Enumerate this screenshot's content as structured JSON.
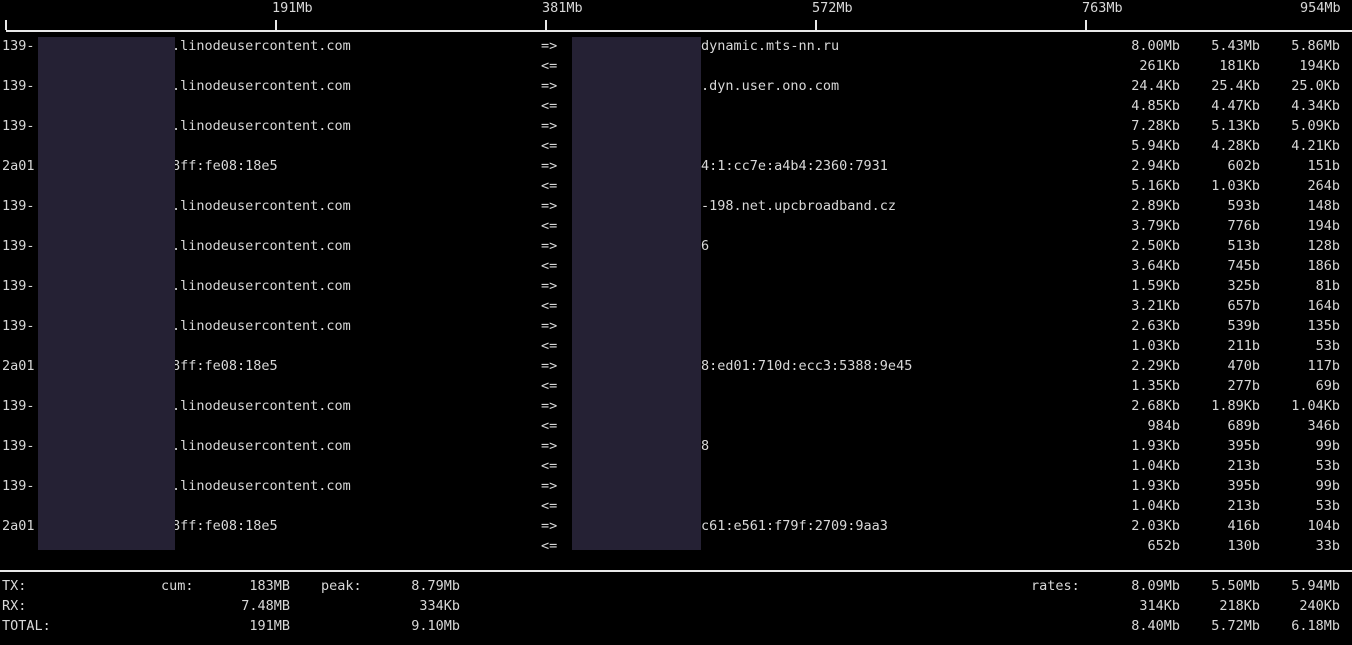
{
  "scale": {
    "ticks": [
      "191Mb",
      "381Mb",
      "572Mb",
      "763Mb",
      "954Mb"
    ]
  },
  "connections": [
    {
      "src": "139-",
      "src_suffix": ".linodeusercontent.com",
      "dst_suffix": "dynamic.mts-nn.ru",
      "tx_arrow": "=>",
      "rx_arrow": "<=",
      "tx": [
        "8.00Mb",
        "5.43Mb",
        "5.86Mb"
      ],
      "rx": [
        "261Kb",
        "181Kb",
        "194Kb"
      ]
    },
    {
      "src": "139-",
      "src_suffix": ".linodeusercontent.com",
      "dst_suffix": ".dyn.user.ono.com",
      "tx_arrow": "=>",
      "rx_arrow": "<=",
      "tx": [
        "24.4Kb",
        "25.4Kb",
        "25.0Kb"
      ],
      "rx": [
        "4.85Kb",
        "4.47Kb",
        "4.34Kb"
      ]
    },
    {
      "src": "139-",
      "src_suffix": ".linodeusercontent.com",
      "dst_suffix": "",
      "tx_arrow": "=>",
      "rx_arrow": "<=",
      "tx": [
        "7.28Kb",
        "5.13Kb",
        "5.09Kb"
      ],
      "rx": [
        "5.94Kb",
        "4.28Kb",
        "4.21Kb"
      ]
    },
    {
      "src": "2a01",
      "src_suffix": "8ff:fe08:18e5",
      "dst_suffix": "4:1:cc7e:a4b4:2360:7931",
      "tx_arrow": "=>",
      "rx_arrow": "<=",
      "tx": [
        "2.94Kb",
        "602b",
        "151b"
      ],
      "rx": [
        "5.16Kb",
        "1.03Kb",
        "264b"
      ]
    },
    {
      "src": "139-",
      "src_suffix": ".linodeusercontent.com",
      "dst_suffix": "-198.net.upcbroadband.cz",
      "tx_arrow": "=>",
      "rx_arrow": "<=",
      "tx": [
        "2.89Kb",
        "593b",
        "148b"
      ],
      "rx": [
        "3.79Kb",
        "776b",
        "194b"
      ]
    },
    {
      "src": "139-",
      "src_suffix": ".linodeusercontent.com",
      "dst_suffix": "6",
      "tx_arrow": "=>",
      "rx_arrow": "<=",
      "tx": [
        "2.50Kb",
        "513b",
        "128b"
      ],
      "rx": [
        "3.64Kb",
        "745b",
        "186b"
      ]
    },
    {
      "src": "139-",
      "src_suffix": ".linodeusercontent.com",
      "dst_suffix": "",
      "tx_arrow": "=>",
      "rx_arrow": "<=",
      "tx": [
        "1.59Kb",
        "325b",
        "81b"
      ],
      "rx": [
        "3.21Kb",
        "657b",
        "164b"
      ]
    },
    {
      "src": "139-",
      "src_suffix": ".linodeusercontent.com",
      "dst_suffix": "",
      "tx_arrow": "=>",
      "rx_arrow": "<=",
      "tx": [
        "2.63Kb",
        "539b",
        "135b"
      ],
      "rx": [
        "1.03Kb",
        "211b",
        "53b"
      ]
    },
    {
      "src": "2a01",
      "src_suffix": "8ff:fe08:18e5",
      "dst_suffix": "8:ed01:710d:ecc3:5388:9e45",
      "tx_arrow": "=>",
      "rx_arrow": "<=",
      "tx": [
        "2.29Kb",
        "470b",
        "117b"
      ],
      "rx": [
        "1.35Kb",
        "277b",
        "69b"
      ]
    },
    {
      "src": "139-",
      "src_suffix": ".linodeusercontent.com",
      "dst_suffix": "",
      "tx_arrow": "=>",
      "rx_arrow": "<=",
      "tx": [
        "2.68Kb",
        "1.89Kb",
        "1.04Kb"
      ],
      "rx": [
        "984b",
        "689b",
        "346b"
      ]
    },
    {
      "src": "139-",
      "src_suffix": ".linodeusercontent.com",
      "dst_suffix": "8",
      "tx_arrow": "=>",
      "rx_arrow": "<=",
      "tx": [
        "1.93Kb",
        "395b",
        "99b"
      ],
      "rx": [
        "1.04Kb",
        "213b",
        "53b"
      ]
    },
    {
      "src": "139-",
      "src_suffix": ".linodeusercontent.com",
      "dst_suffix": "",
      "tx_arrow": "=>",
      "rx_arrow": "<=",
      "tx": [
        "1.93Kb",
        "395b",
        "99b"
      ],
      "rx": [
        "1.04Kb",
        "213b",
        "53b"
      ]
    },
    {
      "src": "2a01",
      "src_suffix": "8ff:fe08:18e5",
      "dst_suffix": "c61:e561:f79f:2709:9aa3",
      "tx_arrow": "=>",
      "rx_arrow": "<=",
      "tx": [
        "2.03Kb",
        "416b",
        "104b"
      ],
      "rx": [
        "652b",
        "130b",
        "33b"
      ]
    }
  ],
  "totals": {
    "tx_label": "TX:",
    "rx_label": "RX:",
    "total_label": "TOTAL:",
    "cum_label": "cum:",
    "peak_label": "peak:",
    "rates_label": "rates:",
    "tx_cum": "183MB",
    "tx_peak": "8.79Mb",
    "tx_rates": [
      "8.09Mb",
      "5.50Mb",
      "5.94Mb"
    ],
    "rx_cum": "7.48MB",
    "rx_peak": "334Kb",
    "rx_rates": [
      "314Kb",
      "218Kb",
      "240Kb"
    ],
    "total_cum": "191MB",
    "total_peak": "9.10Mb",
    "total_rates": [
      "8.40Mb",
      "5.72Mb",
      "6.18Mb"
    ]
  }
}
